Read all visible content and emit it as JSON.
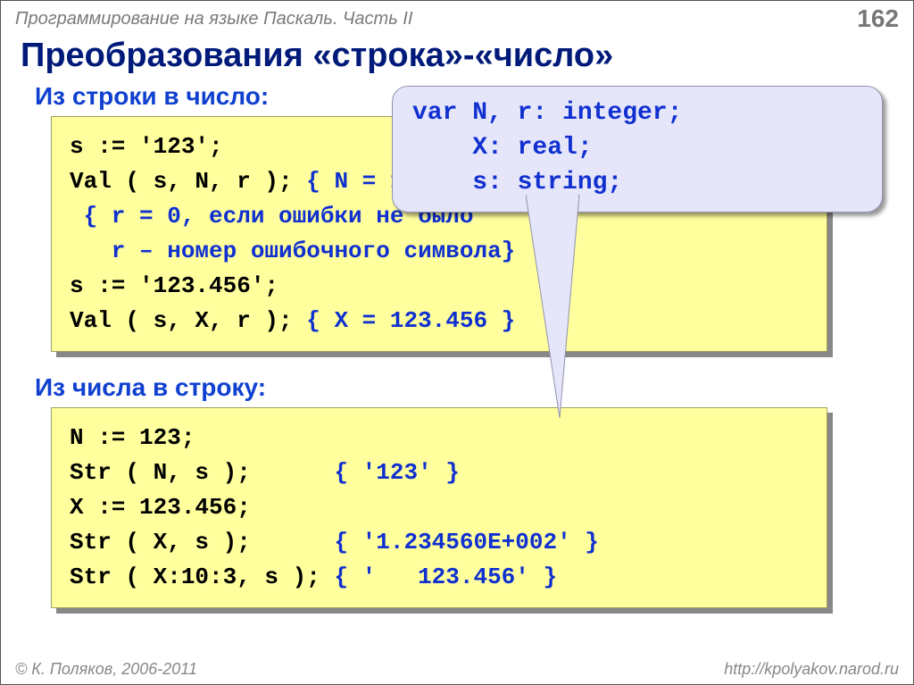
{
  "header": {
    "course": "Программирование на языке Паскаль. Часть II",
    "page": "162"
  },
  "title": "Преобразования «строка»-«число»",
  "section1": {
    "heading": "Из строки в число:",
    "line1_black": "s := '123';",
    "line2_black": "Val ( s, N, r ); ",
    "line2_blue": "{ N = 123 }",
    "line3_blue": " { r = 0, если ошибки не было",
    "line4_blue": "   r – номер ошибочного символа}",
    "line5_black": "s := '123.456';",
    "line6_black": "Val ( s, X, r ); ",
    "line6_blue": "{ X = 123.456 }"
  },
  "callout": {
    "line1": "var N, r: integer;",
    "line2": "    X: real;",
    "line3": "    s: string;"
  },
  "section2": {
    "heading": "Из числа в строку:",
    "line1_black": "N := 123;",
    "line2_black": "Str ( N, s );      ",
    "line2_blue": "{ '123' }",
    "line3_black": "X := 123.456;",
    "line4_black": "Str ( X, s );      ",
    "line4_blue": "{ '1.234560E+002' }",
    "line5_black": "Str ( X:10:3, s ); ",
    "line5_blue": "{ '   123.456' }"
  },
  "footer": {
    "copyright": "© К. Поляков, 2006-2011",
    "url": "http://kpolyakov.narod.ru"
  }
}
